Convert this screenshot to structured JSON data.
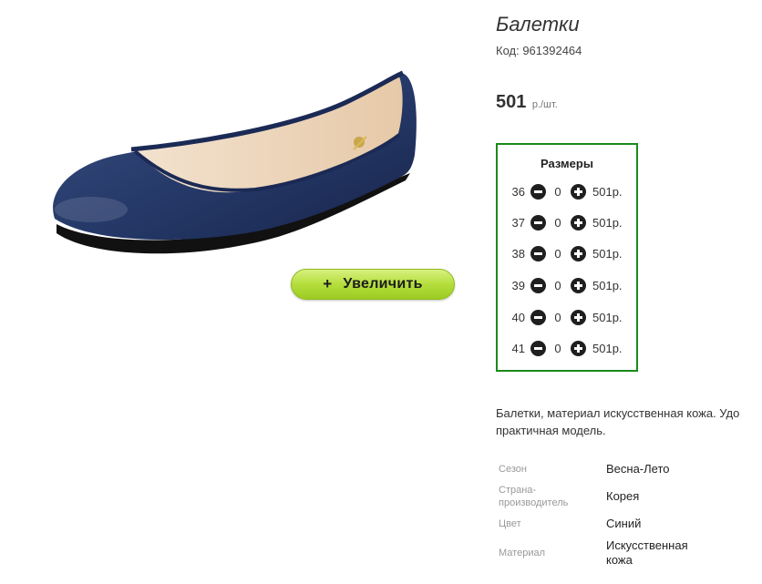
{
  "product": {
    "title": "Балетки",
    "code_label": "Код: 961392464",
    "price_value": "501",
    "price_unit": "р./шт."
  },
  "zoom_button": {
    "icon": "+",
    "label": "Увеличить"
  },
  "sizes": {
    "title": "Размеры",
    "rows": [
      {
        "size": "36",
        "qty": "0",
        "price": "501р."
      },
      {
        "size": "37",
        "qty": "0",
        "price": "501р."
      },
      {
        "size": "38",
        "qty": "0",
        "price": "501р."
      },
      {
        "size": "39",
        "qty": "0",
        "price": "501р."
      },
      {
        "size": "40",
        "qty": "0",
        "price": "501р."
      },
      {
        "size": "41",
        "qty": "0",
        "price": "501р."
      }
    ]
  },
  "description": {
    "line1": "Балетки, материал искусственная кожа. Удо",
    "line2": "практичная модель."
  },
  "specs": [
    {
      "label": "Сезон",
      "value": "Весна-Лето"
    },
    {
      "label_line1": "Страна-",
      "label_line2": "производитель",
      "value": "Корея"
    },
    {
      "label": "Цвет",
      "value": "Синий"
    },
    {
      "label": "Материал",
      "value_line1": "Искусственная",
      "value_line2": "кожа"
    }
  ],
  "colors": {
    "sizes_border": "#1a8a1a",
    "zoom_button": "#b5de3c",
    "shoe": "#223461"
  }
}
